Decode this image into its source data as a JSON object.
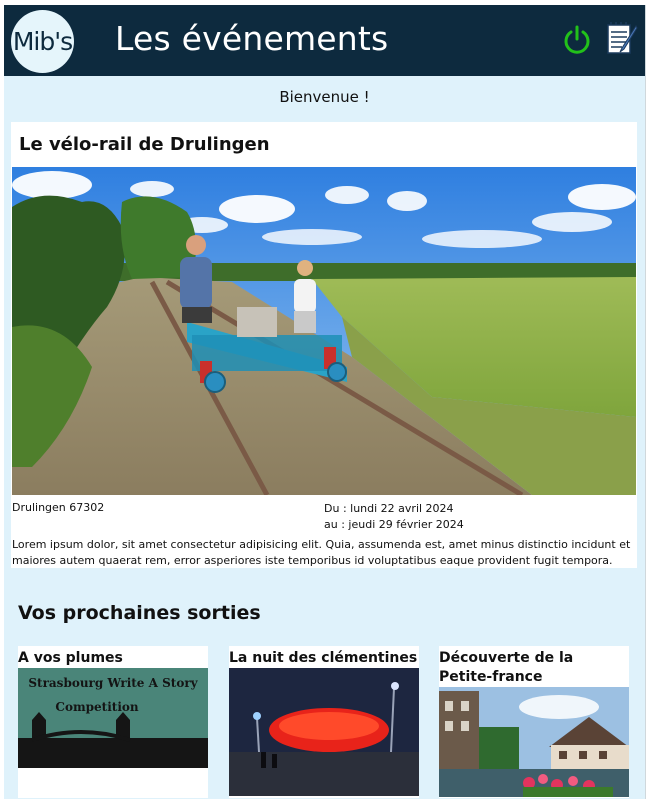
{
  "header": {
    "logo_text": "Mib's",
    "title": "Les événements",
    "power_icon": "power-icon",
    "notes_icon": "notepad-icon",
    "power_color": "#22c11a",
    "background": "#0d2a3e"
  },
  "welcome": "Bienvenue !",
  "event": {
    "title": "Le vélo-rail de Drulingen",
    "location": "Drulingen 67302",
    "date_from": "Du : lundi 22 avril 2024",
    "date_to": "au : jeudi 29 février 2024",
    "description": "Lorem ipsum dolor, sit amet consectetur adipisicing elit. Quia, assumenda est, amet minus distinctio incidunt et maiores autem quaerat rem, error asperiores iste temporibus id voluptatibus eaque provident fugit tempora."
  },
  "upcoming": {
    "title": "Vos prochaines sorties",
    "items": [
      {
        "name": "A vos plumes",
        "image_text_1": "Strasbourg Write A Story",
        "image_text_2": "Competition"
      },
      {
        "name": "La nuit des clémentines"
      },
      {
        "name": "Découverte de la Petite-france"
      }
    ]
  }
}
